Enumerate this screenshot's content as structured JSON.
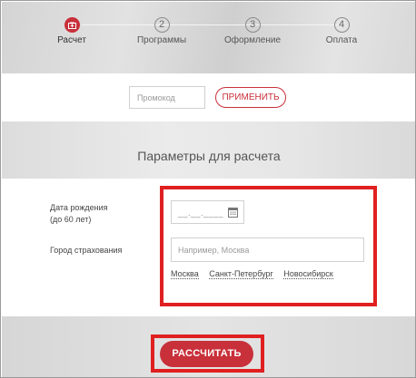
{
  "stepper": {
    "steps": [
      {
        "number": "",
        "label": "Расчет",
        "active": true,
        "icon": "medical-kit-icon"
      },
      {
        "number": "2",
        "label": "Программы",
        "active": false
      },
      {
        "number": "3",
        "label": "Оформление",
        "active": false
      },
      {
        "number": "4",
        "label": "Оплата",
        "active": false
      }
    ]
  },
  "promo": {
    "placeholder": "Промокод",
    "apply_label": "ПРИМЕНИТЬ"
  },
  "params": {
    "title": "Параметры для расчета"
  },
  "form": {
    "birth_label_line1": "Дата рождения",
    "birth_label_line2": "(до 60 лет)",
    "date_placeholder": "__.__.____",
    "city_label": "Город страхования",
    "city_placeholder": "Например, Москва",
    "city_suggestions": [
      "Москва",
      "Санкт-Петербург",
      "Новосибирск"
    ]
  },
  "footer": {
    "calculate_label": "РАССЧИТАТЬ"
  },
  "colors": {
    "accent": "#c8303a",
    "highlight": "#e02020"
  }
}
